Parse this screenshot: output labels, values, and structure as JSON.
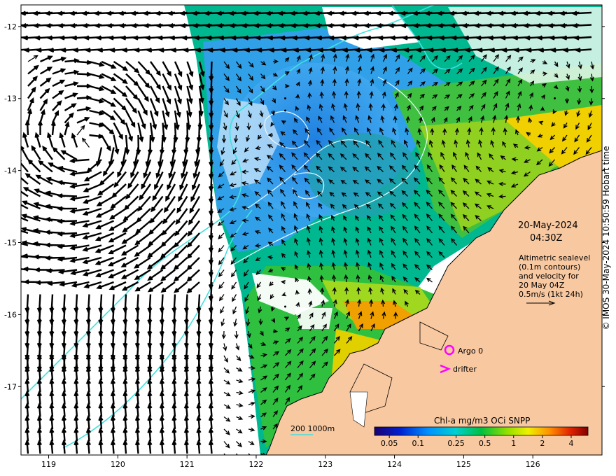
{
  "map": {
    "date": "20-May-2024",
    "time": "04:30Z",
    "legend_lines": [
      "Altimetric sealevel",
      "(0.1m contours)",
      "and velocity for",
      "20 May 04Z",
      "0.5m/s (1kt 24h)"
    ],
    "argo_label": "Argo 0",
    "drifter_label": "drifter",
    "bathymetry_label": "200  1000m",
    "colorbar_title": "Chl-a mg/m3 OCi SNPP",
    "colorbar_ticks": [
      "0.05",
      "0.1",
      "0.25",
      "0.5",
      "1",
      "2",
      "4"
    ],
    "credit": "© IMOS 30-May-2024 10:50:59 Hobart time",
    "lon_ticks": [
      "119",
      "120",
      "121",
      "122",
      "123",
      "124",
      "125",
      "126"
    ],
    "lat_ticks": [
      "-12",
      "-13",
      "-14",
      "-15",
      "-16",
      "-17"
    ],
    "lon_range": [
      118.6,
      127.0
    ],
    "lat_range": [
      -11.7,
      -17.95
    ],
    "argo_position": [
      124.8,
      -16.56
    ],
    "drifter_position": [
      124.74,
      -16.8
    ],
    "colors": {
      "land": "#f8c8a0",
      "bathy_line": "#40e0e0",
      "argo": "#ff00ff",
      "chl_low": "#1e90ff",
      "chl_high": "#8b0000"
    }
  }
}
